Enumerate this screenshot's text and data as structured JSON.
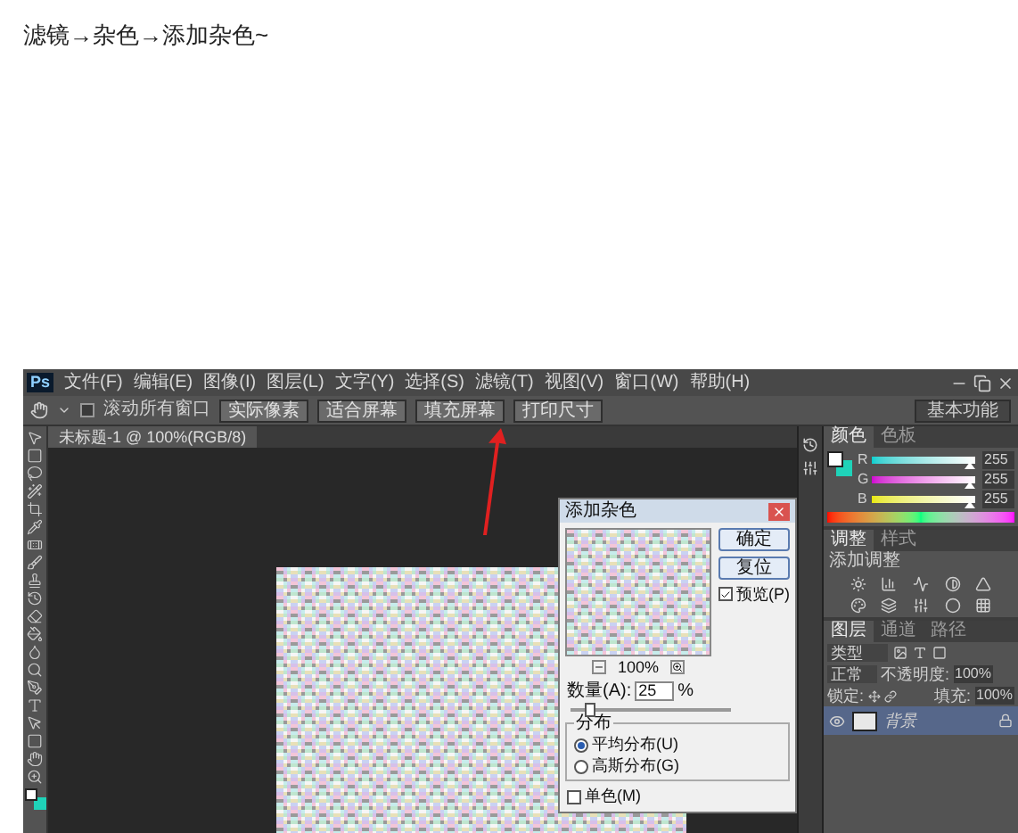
{
  "caption": "滤镜→杂色→添加杂色~",
  "app": {
    "logo": "Ps",
    "menu": [
      "文件(F)",
      "编辑(E)",
      "图像(I)",
      "图层(L)",
      "文字(Y)",
      "选择(S)",
      "滤镜(T)",
      "视图(V)",
      "窗口(W)",
      "帮助(H)"
    ],
    "options": {
      "scroll_all": {
        "label": "滚动所有窗口",
        "checked": false
      },
      "buttons": [
        "实际像素",
        "适合屏幕",
        "填充屏幕",
        "打印尺寸"
      ]
    },
    "workspace": "基本功能",
    "document_tab": "未标题-1 @ 100%(RGB/8)",
    "color_panel": {
      "tabs": [
        {
          "label": "颜色",
          "selected": true
        },
        {
          "label": "色板",
          "selected": false
        }
      ],
      "channels": [
        {
          "name": "R",
          "value": "255",
          "level": 1
        },
        {
          "name": "G",
          "value": "255",
          "level": 1
        },
        {
          "name": "B",
          "value": "255",
          "level": 1
        }
      ]
    },
    "adjust_panel": {
      "tabs": [
        {
          "label": "调整",
          "selected": true
        },
        {
          "label": "样式",
          "selected": false
        }
      ],
      "heading": "添加调整"
    },
    "layers_panel": {
      "tabs": [
        {
          "label": "图层",
          "selected": true
        },
        {
          "label": "通道",
          "selected": false
        },
        {
          "label": "路径",
          "selected": false
        }
      ],
      "filter": "类型",
      "blend_mode": "正常",
      "opacity_label": "不透明度:",
      "opacity": "100%",
      "lock_label": "锁定:",
      "fill_label": "填充:",
      "fill": "100%",
      "layers": [
        {
          "name": "背景",
          "selected": true,
          "visible": true,
          "locked": true
        }
      ]
    },
    "dialog": {
      "title": "添加杂色",
      "buttons": [
        "确定",
        "复位"
      ],
      "preview": {
        "label": "预览(P)",
        "checked": true
      },
      "zoom": "100%",
      "amount_label": "数量(A):",
      "amount": "25",
      "unit": "%",
      "amount_slider": {
        "level": 0.12
      },
      "distribution": {
        "title": "分布",
        "options": [
          {
            "label": "平均分布(U)",
            "selected": true
          },
          {
            "label": "高斯分布(G)",
            "selected": false
          }
        ]
      },
      "monochrome": {
        "label": "单色(M)",
        "checked": false
      }
    }
  }
}
